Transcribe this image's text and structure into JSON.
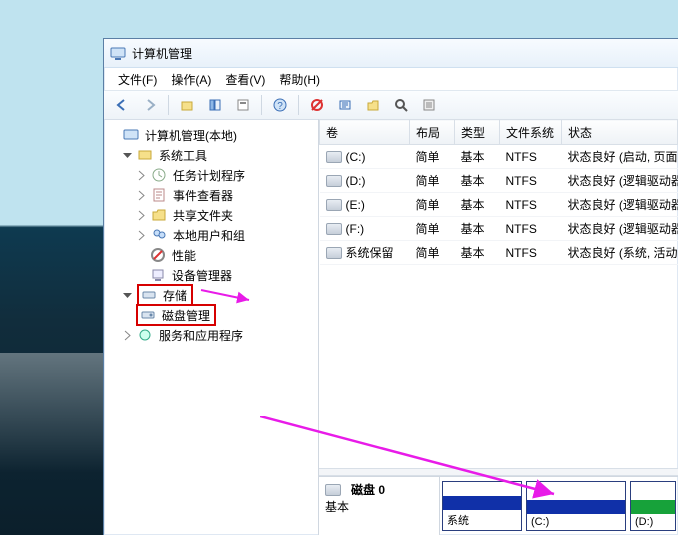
{
  "window": {
    "title": "计算机管理"
  },
  "menu": {
    "file": "文件(F)",
    "action": "操作(A)",
    "view": "查看(V)",
    "help": "帮助(H)"
  },
  "tree": {
    "root": "计算机管理(本地)",
    "systools": "系统工具",
    "sched": "任务计划程序",
    "event": "事件查看器",
    "shared": "共享文件夹",
    "users": "本地用户和组",
    "perf": "性能",
    "devmgr": "设备管理器",
    "storage": "存储",
    "diskmgmt": "磁盘管理",
    "services": "服务和应用程序"
  },
  "cols": {
    "vol": "卷",
    "layout": "布局",
    "type": "类型",
    "fs": "文件系统",
    "status": "状态"
  },
  "rows": [
    {
      "vol": "(C:)",
      "layout": "简单",
      "type": "基本",
      "fs": "NTFS",
      "status": "状态良好 (启动, 页面"
    },
    {
      "vol": "(D:)",
      "layout": "简单",
      "type": "基本",
      "fs": "NTFS",
      "status": "状态良好 (逻辑驱动器"
    },
    {
      "vol": "(E:)",
      "layout": "简单",
      "type": "基本",
      "fs": "NTFS",
      "status": "状态良好 (逻辑驱动器"
    },
    {
      "vol": "(F:)",
      "layout": "简单",
      "type": "基本",
      "fs": "NTFS",
      "status": "状态良好 (逻辑驱动器"
    },
    {
      "vol": "系统保留",
      "layout": "简单",
      "type": "基本",
      "fs": "NTFS",
      "status": "状态良好 (系统, 活动"
    }
  ],
  "disk": {
    "label": "磁盘 0",
    "kind": "基本",
    "parts": [
      {
        "name": "系统",
        "color": "#1030a8"
      },
      {
        "name": "(C:)",
        "color": "#1030a8"
      },
      {
        "name": "(D:)",
        "color": "#17a23a"
      }
    ]
  }
}
